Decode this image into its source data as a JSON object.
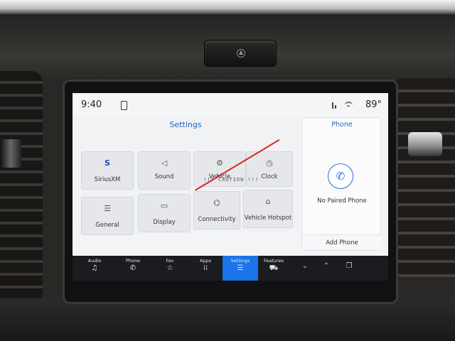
{
  "status": {
    "time": "9:40",
    "temperature": "89°"
  },
  "settings": {
    "title": "Settings",
    "tiles": [
      {
        "label": "SiriusXM",
        "icon": "siriusxm-icon",
        "glyph": "S"
      },
      {
        "label": "Sound",
        "icon": "speaker-icon",
        "glyph": "◁"
      },
      {
        "label": "Vehicle",
        "icon": "vehicle-icon",
        "glyph": "⚙"
      },
      {
        "label": "Clock",
        "icon": "clock-icon",
        "glyph": "◷"
      },
      {
        "label": "General",
        "icon": "sliders-icon",
        "glyph": "☰"
      },
      {
        "label": "Display",
        "icon": "display-icon",
        "glyph": "▭"
      },
      {
        "label": "Connectivity",
        "icon": "connectivity-icon",
        "glyph": "⌬"
      },
      {
        "label": "Vehicle Hotspot",
        "icon": "hotspot-icon",
        "glyph": "⌂"
      }
    ],
    "caution": "!!! CAUTION !!!"
  },
  "phone": {
    "title": "Phone",
    "status": "No Paired Phone",
    "add_button": "Add Phone"
  },
  "nav": {
    "items": [
      {
        "label": "Audio",
        "icon": "music-note-icon",
        "glyph": "♫"
      },
      {
        "label": "Phone",
        "icon": "phone-icon",
        "glyph": "✆"
      },
      {
        "label": "Fav",
        "icon": "star-icon",
        "glyph": "☆"
      },
      {
        "label": "Apps",
        "icon": "grid-icon",
        "glyph": "⁞⁞"
      },
      {
        "label": "Settings",
        "icon": "settings-sliders-icon",
        "glyph": "☰"
      },
      {
        "label": "Features",
        "icon": "car-icon",
        "glyph": "⛟"
      }
    ],
    "active": "Settings"
  },
  "colors": {
    "accent": "#1a73e8",
    "title_blue": "#1f63c4",
    "nav_bg": "#1b1c20",
    "caution_line": "#d22a2a"
  }
}
